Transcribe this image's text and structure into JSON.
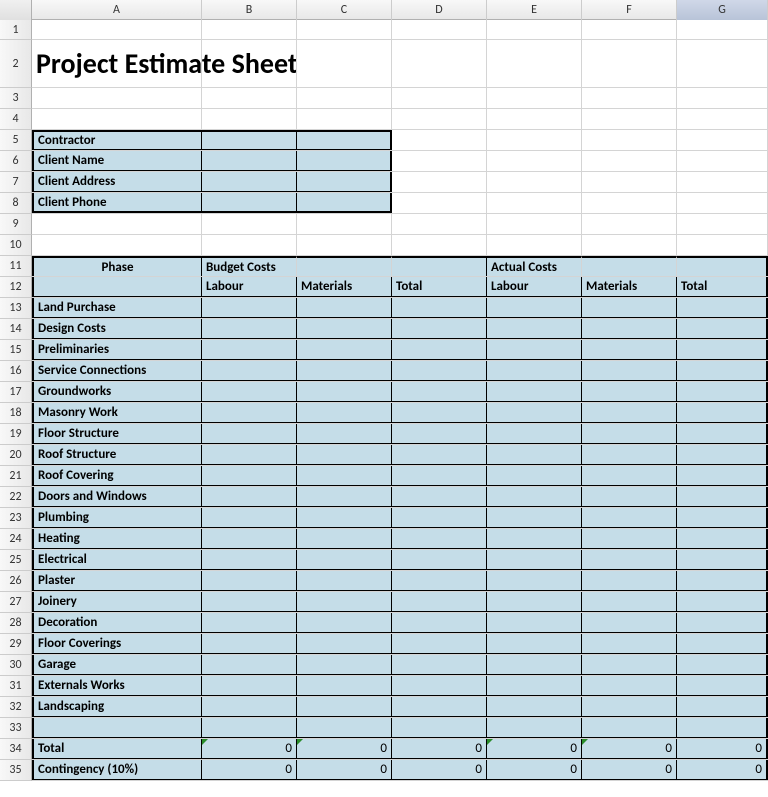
{
  "columns": [
    "A",
    "B",
    "C",
    "D",
    "E",
    "F",
    "G"
  ],
  "selectedColumn": "G",
  "title": "Project Estimate Sheet",
  "clientInfo": {
    "rows": [
      {
        "label": "Contractor"
      },
      {
        "label": "Client Name"
      },
      {
        "label": "Client Address"
      },
      {
        "label": "Client Phone"
      }
    ]
  },
  "headers": {
    "phase": "Phase",
    "budgetCosts": "Budget Costs",
    "actualCosts": "Actual Costs",
    "labour": "Labour",
    "materials": "Materials",
    "total": "Total"
  },
  "phases": [
    "Land Purchase",
    "Design Costs",
    "Preliminaries",
    "Service Connections",
    "Groundworks",
    "Masonry Work",
    "Floor Structure",
    "Roof Structure",
    "Roof Covering",
    "Doors and Windows",
    "Plumbing",
    "Heating",
    "Electrical",
    "Plaster",
    "Joinery",
    "Decoration",
    "Floor Coverings",
    "Garage",
    "Externals Works",
    "Landscaping"
  ],
  "totals": {
    "totalLabel": "Total",
    "contingencyLabel": "Contingency (10%)",
    "values": [
      "0",
      "0",
      "0",
      "0",
      "0",
      "0"
    ]
  },
  "rowNumbers": [
    1,
    2,
    3,
    4,
    5,
    6,
    7,
    8,
    9,
    10,
    11,
    12,
    13,
    14,
    15,
    16,
    17,
    18,
    19,
    20,
    21,
    22,
    23,
    24,
    25,
    26,
    27,
    28,
    29,
    30,
    31,
    32,
    33,
    34,
    35
  ]
}
